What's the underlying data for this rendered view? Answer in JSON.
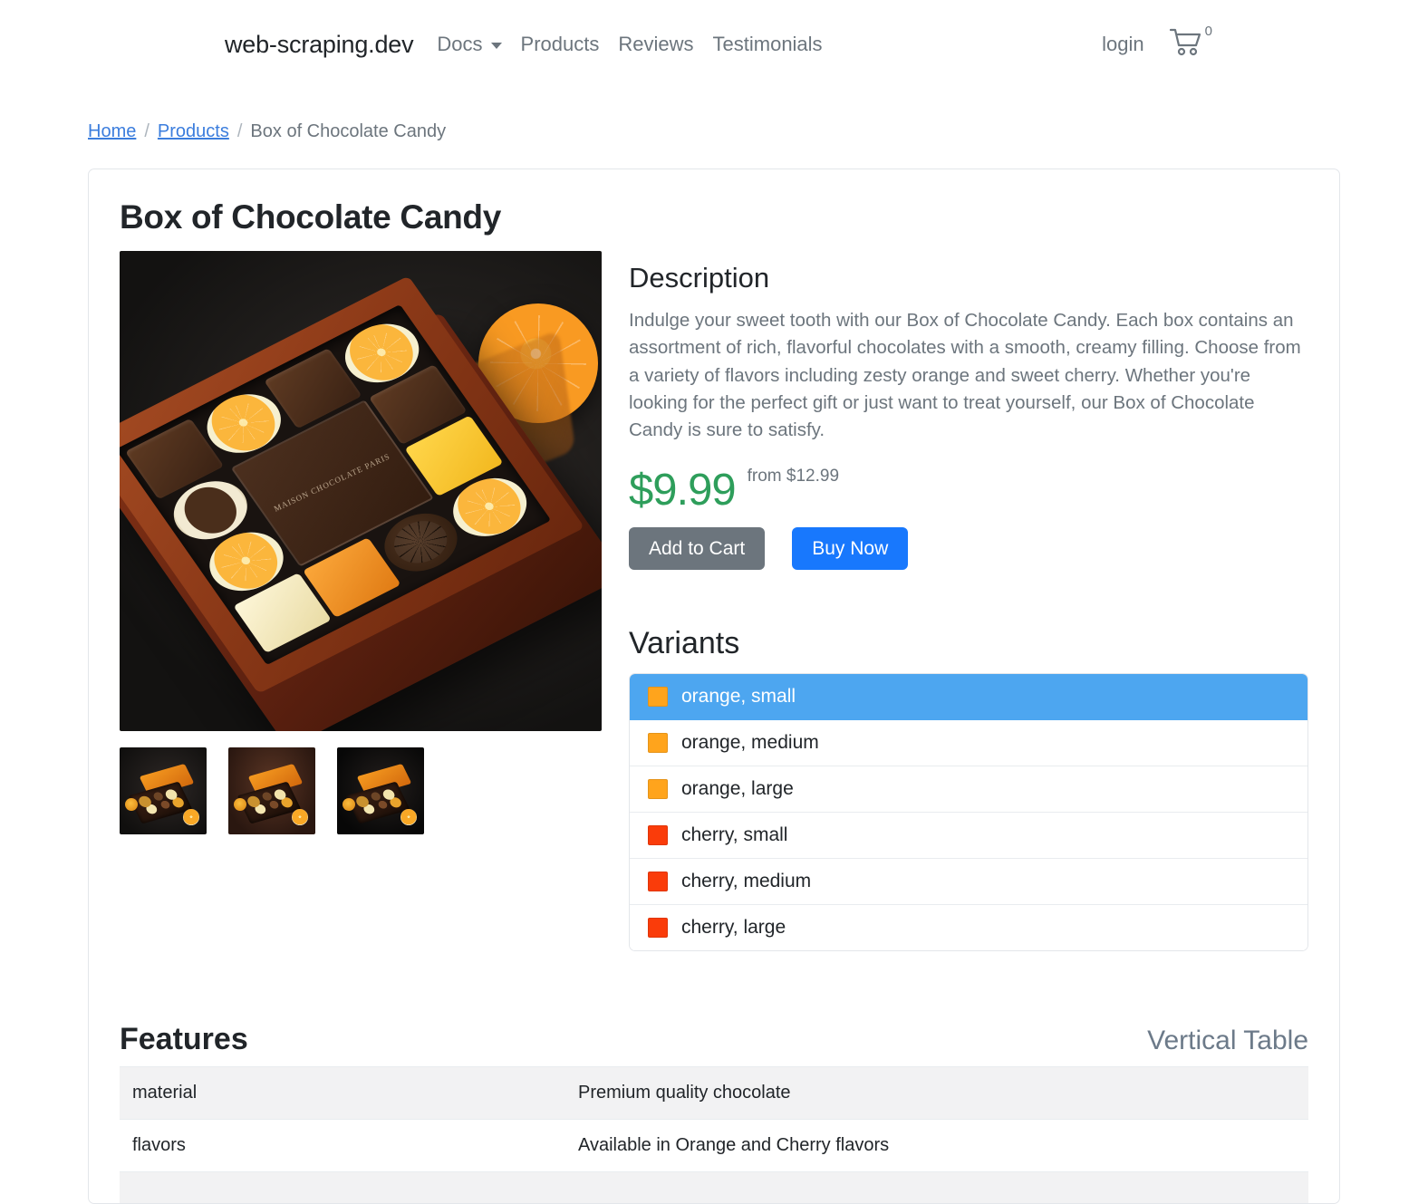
{
  "navbar": {
    "brand": "web-scraping.dev",
    "links": [
      {
        "label": "Docs",
        "has_caret": true
      },
      {
        "label": "Products",
        "has_caret": false
      },
      {
        "label": "Reviews",
        "has_caret": false
      },
      {
        "label": "Testimonials",
        "has_caret": false
      }
    ],
    "login_label": "login",
    "cart_icon": "shopping-cart-icon",
    "cart_count": "0"
  },
  "breadcrumb": {
    "home": "Home",
    "products": "Products",
    "separator": "/",
    "current": "Box of Chocolate Candy"
  },
  "product": {
    "title": "Box of Chocolate Candy",
    "image_alt": "Box of Chocolate Candy",
    "plaque_text": "MAISON CHOCOLATE PARIS",
    "description_heading": "Description",
    "description": "Indulge your sweet tooth with our Box of Chocolate Candy. Each box contains an assortment of rich, flavorful chocolates with a smooth, creamy filling. Choose from a variety of flavors including zesty orange and sweet cherry. Whether you're looking for the perfect gift or just want to treat yourself, our Box of Chocolate Candy is sure to satisfy.",
    "price": "$9.99",
    "price_from": "from $12.99",
    "add_to_cart_label": "Add to Cart",
    "buy_now_label": "Buy Now"
  },
  "variants": {
    "heading": "Variants",
    "items": [
      {
        "label": "orange, small",
        "color": "#FFA41C",
        "selected": true
      },
      {
        "label": "orange, medium",
        "color": "#FFA41C",
        "selected": false
      },
      {
        "label": "orange, large",
        "color": "#FFA41C",
        "selected": false
      },
      {
        "label": "cherry, small",
        "color": "#FA3C0A",
        "selected": false
      },
      {
        "label": "cherry, medium",
        "color": "#FA3C0A",
        "selected": false
      },
      {
        "label": "cherry, large",
        "color": "#FA3C0A",
        "selected": false
      }
    ]
  },
  "features": {
    "heading": "Features",
    "vertical_table_label": "Vertical Table",
    "rows": [
      {
        "key": "material",
        "value": "Premium quality chocolate"
      },
      {
        "key": "flavors",
        "value": "Available in Orange and Cherry flavors"
      },
      {
        "key": "",
        "value": ""
      }
    ]
  },
  "colors": {
    "accent_blue": "#1878FD",
    "selected_blue": "#4DA6F0",
    "price_green": "#2E9E5B",
    "muted_gray": "#6C757D",
    "link_blue": "#3B7DDD"
  }
}
